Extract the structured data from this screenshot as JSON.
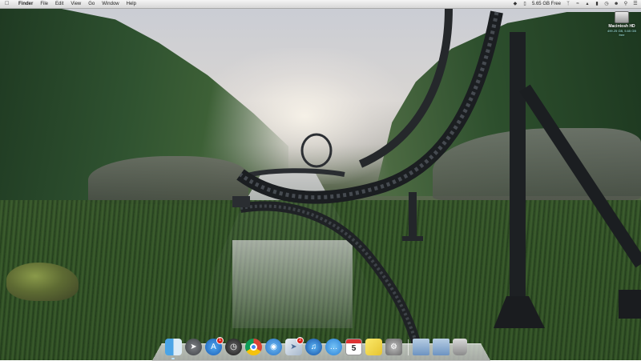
{
  "menubar": {
    "apple_icon": "apple-icon",
    "app_name": "Finder",
    "items": [
      "File",
      "Edit",
      "View",
      "Go",
      "Window",
      "Help"
    ],
    "status": {
      "disk_free": "5.65 GB Free",
      "icons": [
        "dropbox-icon",
        "bluetooth-icon",
        "wifi-icon",
        "volume-icon",
        "battery-icon",
        "clock-icon",
        "user-icon",
        "spotlight-icon",
        "notifications-icon"
      ]
    }
  },
  "desktop": {
    "drive": {
      "name": "Macintosh HD",
      "info": "499.25 GB, 5.65 GB free"
    }
  },
  "dock": {
    "apps": [
      {
        "name": "Finder",
        "icon": "finder-icon"
      },
      {
        "name": "Launchpad",
        "icon": "launchpad-icon"
      },
      {
        "name": "App Store",
        "icon": "app-store-icon",
        "badge": "1"
      },
      {
        "name": "Dashboard",
        "icon": "dashboard-icon"
      },
      {
        "name": "Google Chrome",
        "icon": "chrome-icon"
      },
      {
        "name": "Aliens",
        "icon": "alien-icon"
      },
      {
        "name": "Mail",
        "icon": "mail-icon",
        "badge": "2"
      },
      {
        "name": "iTunes",
        "icon": "itunes-icon"
      },
      {
        "name": "Messages",
        "icon": "messages-icon"
      },
      {
        "name": "Calendar",
        "icon": "calendar-icon",
        "day": "5"
      },
      {
        "name": "Stickies",
        "icon": "stickies-icon"
      },
      {
        "name": "System Preferences",
        "icon": "system-preferences-icon"
      }
    ],
    "stacks": [
      {
        "name": "Applications",
        "icon": "folder-icon"
      },
      {
        "name": "Downloads",
        "icon": "folder-icon"
      }
    ],
    "trash": {
      "name": "Trash",
      "icon": "trash-icon"
    }
  }
}
